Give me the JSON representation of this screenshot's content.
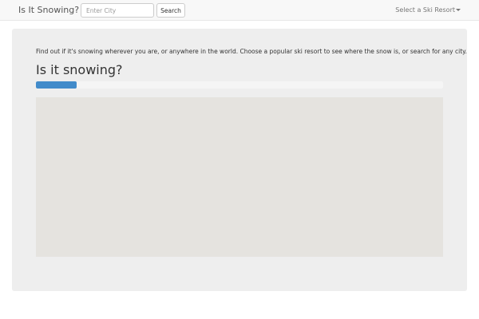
{
  "navbar": {
    "brand": "Is It Snowing?",
    "city_placeholder": "Enter City",
    "search_label": "Search",
    "resort_label": "Select a Ski Resort"
  },
  "main": {
    "intro": "Find out if it's snowing wherever you are, or anywhere in the world. Choose a popular ski resort to see where the snow is, or search for any city.",
    "heading": "Is it snowing?",
    "progress_fraction": 0.1
  },
  "colors": {
    "progress_bar": "#428bca",
    "map_background": "#e5e3df",
    "panel_background": "#eeeeee"
  },
  "icons": {
    "dropdown": "caret-down-icon"
  }
}
